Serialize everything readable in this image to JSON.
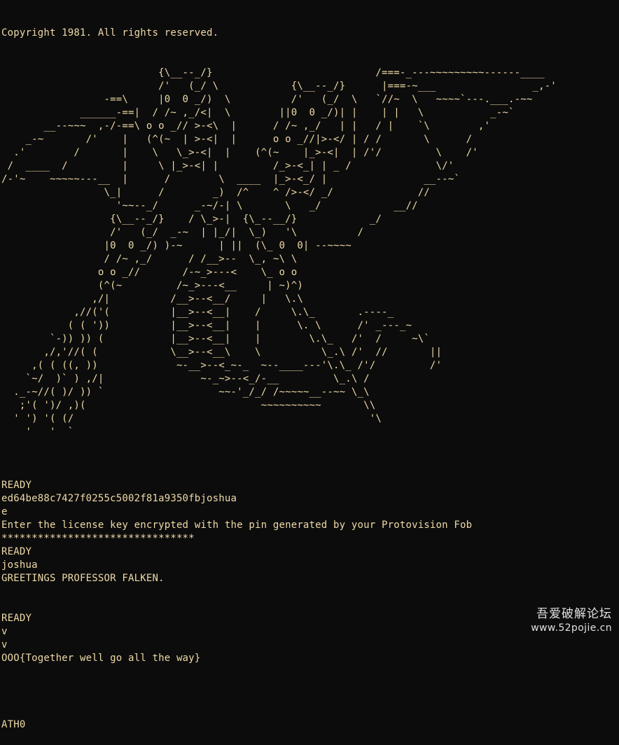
{
  "terminal": {
    "copyright": "Copyright 1981. All rights reserved.",
    "art_lines": [
      "                          {\\__--_/}                           /===-_---~~~~~~~~~------____",
      "                          /'   (_/ \\            {\\__--_/}      |===-~___                _,-'",
      "                 -==\\     |0  0 _/)  \\          /'   (_/  \\   `//~  \\   ~~~~`---.___.-~~",
      "             ______-==|  / /~ ,_/<|  \\        ||0  0 _/)| |    | |   \\           _-~`",
      "       __--~~~  ,-/-==\\ o o _// >-<\\  |      / /~ ,_/   | |   / |    `\\        ,'",
      "    _-~       /'    |   (^(~  | >-<|  |      o o _//|>-</ | / /       \\      /",
      "  .'        /       |    \\   \\_>-<|  |    (^(~    |_>-<|  | /'/         \\    /'",
      " /  ____  /         |     \\ |_>-<| |         /_>-<_| | _ /              \\/'",
      "/-'~    ~~~~~---__  |      /        \\  ____  |_>-<_/ |                __--~`",
      "                 \\_|      /        _)  /^    ^ />-</ _/              //",
      "                   '~~--_/      _-~/-| \\       \\   _/            __//",
      "                  {\\__--_/}    / \\_>-|  {\\_--__/}            _/",
      "                  /'   (_/  _-~  | |_/|  \\_)   '\\          /",
      "                 |0  0 _/) )-~      | ||  (\\_ 0  0| --~~~~",
      "                 / /~ ,_/      / /__>--  \\_, ~\\ \\",
      "                o o _//       /-~_>---<    \\_ o o",
      "                (^(~         /~_>---<__     | ~)^)",
      "               ,/|          /__>--<__/     |   \\.\\",
      "            ,//('(          |__>--<__|    /     \\.\\_       .----_",
      "           ( ( '))          |__>--<__|    |      \\. \\      /' _---_~",
      "        `-)) )) (           |__>--<__|    |        \\.\\_   /'  /     ~\\`",
      "       ,/,'//( (            \\__>--<__\\    \\          \\_.\\ /'  //       ||",
      "     ,( ( ((, ))             ~-__>--<_~-_  ~--____---'\\.\\_ /'/         /'",
      "    `~/  )` ) ,/|                ~-_~>--<_/-__         \\_.\\ /",
      "  ._-~//( )/ )) `                   ~~-'_/_/ /~~~~~__--~~ \\_\\",
      "   ;'( ')/ ,)(                             ~~~~~~~~~~       \\\\",
      "  ' ') '( (/                                                 '\\",
      "    '   '  `"
    ],
    "output_lines": [
      "",
      "READY",
      "ed64be88c7427f0255c5002f81a9350fbjoshua",
      "e",
      "Enter the license key encrypted with the pin generated by your Protovision Fob",
      "********************************",
      "READY",
      "joshua",
      "GREETINGS PROFESSOR FALKEN.",
      "",
      "",
      "READY",
      "v",
      "v",
      "OOO{Together well go all the way}",
      "",
      "",
      "",
      "",
      "ATH0"
    ]
  },
  "watermark": {
    "title": "吾爱破解论坛",
    "url": "www.52pojie.cn"
  },
  "colors": {
    "background": "#0c0c0c",
    "text": "#efdaa8",
    "watermark": "#f2f2f2"
  }
}
